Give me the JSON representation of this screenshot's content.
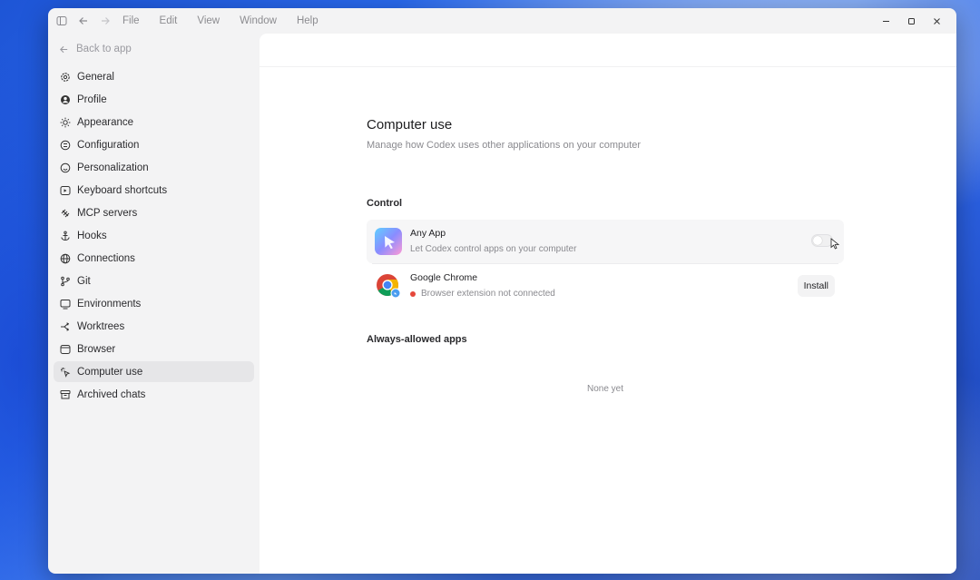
{
  "menu": [
    "File",
    "Edit",
    "View",
    "Window",
    "Help"
  ],
  "sidebar": {
    "back_label": "Back to app",
    "items": [
      {
        "label": "General",
        "icon": "gear-icon"
      },
      {
        "label": "Profile",
        "icon": "user-circle-icon"
      },
      {
        "label": "Appearance",
        "icon": "sun-icon"
      },
      {
        "label": "Configuration",
        "icon": "settings-sliders-icon"
      },
      {
        "label": "Personalization",
        "icon": "smile-icon"
      },
      {
        "label": "Keyboard shortcuts",
        "icon": "keyboard-icon"
      },
      {
        "label": "MCP servers",
        "icon": "mcp-icon"
      },
      {
        "label": "Hooks",
        "icon": "anchor-icon"
      },
      {
        "label": "Connections",
        "icon": "globe-icon"
      },
      {
        "label": "Git",
        "icon": "git-branch-icon"
      },
      {
        "label": "Environments",
        "icon": "monitor-icon"
      },
      {
        "label": "Worktrees",
        "icon": "worktree-icon"
      },
      {
        "label": "Browser",
        "icon": "browser-window-icon"
      },
      {
        "label": "Computer use",
        "icon": "pointer-icon",
        "active": true
      },
      {
        "label": "Archived chats",
        "icon": "archive-icon"
      }
    ]
  },
  "main": {
    "title": "Computer use",
    "subtitle": "Manage how Codex uses other applications on your computer",
    "control_heading": "Control",
    "control_items": [
      {
        "title": "Any App",
        "desc": "Let Codex control apps on your computer",
        "toggle": "off"
      },
      {
        "title": "Google Chrome",
        "desc": "Browser extension not connected",
        "status_color": "#e5473b",
        "action": "Install"
      }
    ],
    "allowed_heading": "Always-allowed apps",
    "allowed_empty": "None yet"
  }
}
